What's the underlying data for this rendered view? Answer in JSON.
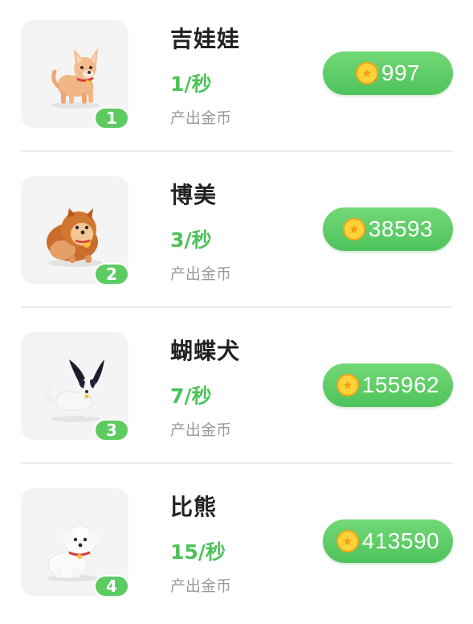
{
  "items": [
    {
      "name": "吉娃娃",
      "rate": "1/秒",
      "caption": "产出金币",
      "level": "1",
      "price": "997",
      "icon": "chihuahua-icon"
    },
    {
      "name": "博美",
      "rate": "3/秒",
      "caption": "产出金币",
      "level": "2",
      "price": "38593",
      "icon": "pomeranian-icon"
    },
    {
      "name": "蝴蝶犬",
      "rate": "7/秒",
      "caption": "产出金币",
      "level": "3",
      "price": "155962",
      "icon": "papillon-icon"
    },
    {
      "name": "比熊",
      "rate": "15/秒",
      "caption": "产出金币",
      "level": "4",
      "price": "413590",
      "icon": "bichon-icon"
    }
  ],
  "colors": {
    "accent": "#4cc259",
    "button": "#5ccb62",
    "coin": "#ffd23a"
  }
}
